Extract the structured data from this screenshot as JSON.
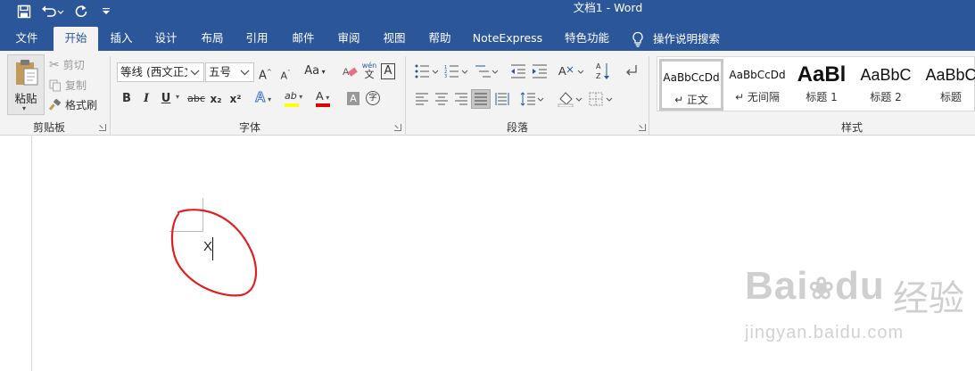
{
  "window": {
    "title": "文档1  -  Word"
  },
  "quick_access": {
    "icons": [
      "save-icon",
      "undo-icon",
      "redo-icon",
      "customize-icon"
    ]
  },
  "tabs": [
    {
      "label": "文件"
    },
    {
      "label": "开始",
      "active": true
    },
    {
      "label": "插入"
    },
    {
      "label": "设计"
    },
    {
      "label": "布局"
    },
    {
      "label": "引用"
    },
    {
      "label": "邮件"
    },
    {
      "label": "审阅"
    },
    {
      "label": "视图"
    },
    {
      "label": "帮助"
    },
    {
      "label": "NoteExpress"
    },
    {
      "label": "特色功能"
    }
  ],
  "tell_me": {
    "label": "操作说明搜索"
  },
  "clipboard": {
    "paste": "粘贴",
    "cut": "剪切",
    "copy": "复制",
    "format_painter": "格式刷",
    "label": "剪贴板"
  },
  "font": {
    "family": "等线 (西文正文",
    "size": "五号",
    "case_label": "Aa",
    "phonetic_top": "wén",
    "phonetic_bottom": "文",
    "border_char": "A",
    "bold": "B",
    "italic": "I",
    "underline": "U",
    "strikethrough": "abc",
    "subscript": "x₂",
    "superscript": "x²",
    "text_effects": "A",
    "highlight": "ab",
    "font_color": "A",
    "shading_char": "A",
    "enclose_char": "字",
    "grow": "A",
    "shrink": "A",
    "label": "字体"
  },
  "paragraph": {
    "label": "段落"
  },
  "styles": {
    "items": [
      {
        "sample": "AaBbCcDd",
        "name": "↵ 正文"
      },
      {
        "sample": "AaBbCcDd",
        "name": "↵ 无间隔"
      },
      {
        "sample": "AaBl",
        "name": "标题 1"
      },
      {
        "sample": "AaBbC",
        "name": "标题 2"
      },
      {
        "sample": "AaBbC",
        "name": "标题"
      }
    ],
    "label": "样式"
  },
  "document": {
    "text": "X"
  },
  "colors": {
    "brand": "#2b579a",
    "ribbon_bg": "#f3f3f3",
    "highlight_yellow": "#ffff00",
    "font_red": "#e00000",
    "annotation_red": "#e02020"
  },
  "watermark": {
    "main": "Bai",
    "main2": "du",
    "cn": "经验",
    "url": "jingyan.baidu.com"
  }
}
